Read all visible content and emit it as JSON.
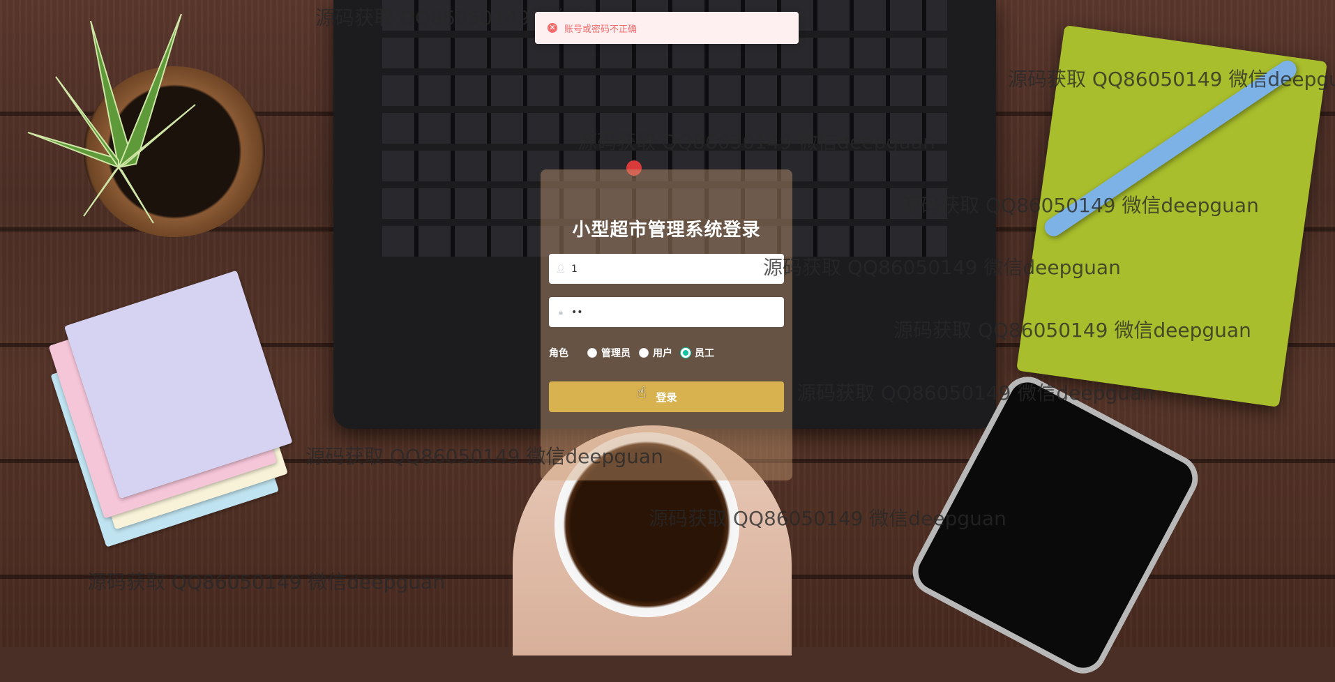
{
  "alert": {
    "message": "账号或密码不正确",
    "icon": "error-circle-icon",
    "color": "#f56c6c"
  },
  "login": {
    "title": "小型超市管理系统登录",
    "username": {
      "value": "1",
      "icon": "user-icon"
    },
    "password": {
      "value": "••",
      "icon": "lock-icon"
    },
    "role_label": "角色",
    "roles": [
      {
        "label": "管理员",
        "checked": false
      },
      {
        "label": "用户",
        "checked": false
      },
      {
        "label": "员工",
        "checked": true
      }
    ],
    "submit_label": "登录",
    "accent_color": "#d8b24e",
    "radio_color": "#13c2a3"
  },
  "watermark": "源码获取 QQ86050149 微信deepguan"
}
